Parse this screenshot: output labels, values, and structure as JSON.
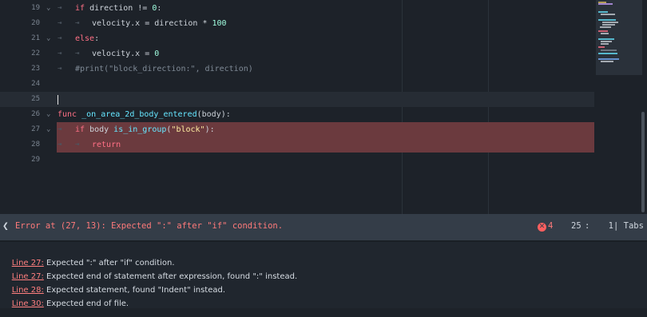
{
  "editor": {
    "lines": [
      {
        "num": "19",
        "fold": true,
        "segs": [
          {
            "t": "if",
            "c": "kw"
          },
          {
            "t": " direction != ",
            "c": ""
          },
          {
            "t": "0",
            "c": "num"
          },
          {
            "t": ":",
            "c": ""
          }
        ]
      },
      {
        "num": "20",
        "fold": false,
        "segs": [
          {
            "t": "velocity.x = direction * ",
            "c": ""
          },
          {
            "t": "100",
            "c": "num"
          }
        ]
      },
      {
        "num": "21",
        "fold": true,
        "segs": [
          {
            "t": "else",
            "c": "kw"
          },
          {
            "t": ":",
            "c": ""
          }
        ]
      },
      {
        "num": "22",
        "fold": false,
        "segs": [
          {
            "t": "velocity.x = ",
            "c": ""
          },
          {
            "t": "0",
            "c": "num"
          }
        ]
      },
      {
        "num": "23",
        "fold": false,
        "segs": [
          {
            "t": "#print(\"block_direction:\", direction)",
            "c": "cm"
          }
        ]
      },
      {
        "num": "24",
        "fold": false,
        "segs": []
      },
      {
        "num": "25",
        "fold": false,
        "segs": []
      },
      {
        "num": "26",
        "fold": true,
        "segs": [
          {
            "t": "func",
            "c": "kw"
          },
          {
            "t": " ",
            "c": ""
          },
          {
            "t": "_on_area_2d_body_entered",
            "c": "fn"
          },
          {
            "t": "(body):",
            "c": ""
          }
        ]
      },
      {
        "num": "27",
        "fold": true,
        "segs": [
          {
            "t": "if",
            "c": "kw"
          },
          {
            "t": " body ",
            "c": ""
          },
          {
            "t": "is_in_group",
            "c": "fn"
          },
          {
            "t": "(",
            "c": ""
          },
          {
            "t": "\"block\"",
            "c": "str"
          },
          {
            "t": "):",
            "c": ""
          }
        ]
      },
      {
        "num": "28",
        "fold": false,
        "segs": [
          {
            "t": "return",
            "c": "kw"
          }
        ]
      },
      {
        "num": "29",
        "fold": false,
        "segs": []
      }
    ]
  },
  "status": {
    "collapse_icon": "chevron-left-icon",
    "message": "Error at (27, 13): Expected \":\" after \"if\" condition.",
    "error_count": "4",
    "line": "25",
    "separator": ":",
    "column": "1",
    "indent_mode": "| Tabs"
  },
  "errors": [
    {
      "link": "Line 27:",
      "text": " Expected \":\" after \"if\" condition."
    },
    {
      "link": "Line 27:",
      "text": " Expected end of statement after expression, found \":\" instead."
    },
    {
      "link": "Line 28:",
      "text": " Expected statement, found \"Indent\" instead."
    },
    {
      "link": "Line 30:",
      "text": " Expected end of file."
    }
  ],
  "colors": {
    "keyword": "#ff7085",
    "function": "#66e6ff",
    "number": "#a1ffe0",
    "string": "#ffeda1",
    "comment": "#7f8a96",
    "error_line_bg": "#6b3a3e",
    "error_text": "#ff7a7a"
  }
}
